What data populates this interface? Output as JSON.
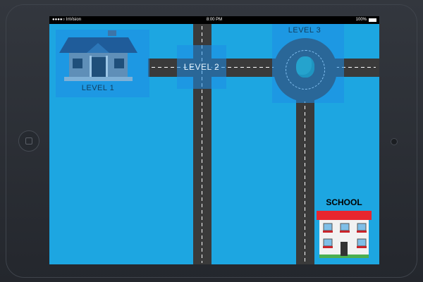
{
  "status_bar": {
    "carrier": "●●●●○ InVision",
    "wifi_icon": "wifi-icon",
    "time": "8:00 PM",
    "battery": "100%"
  },
  "map": {
    "level_1_label": "LEVEL 1",
    "level_2_label": "LEVEL 2",
    "level_3_label": "LEVEL 3",
    "school_label": "SCHOOL"
  },
  "colors": {
    "background": "#1da6e1",
    "road": "#3a3a3a",
    "hotspot": "#1e8ce6",
    "school_roof": "#e8262e"
  }
}
